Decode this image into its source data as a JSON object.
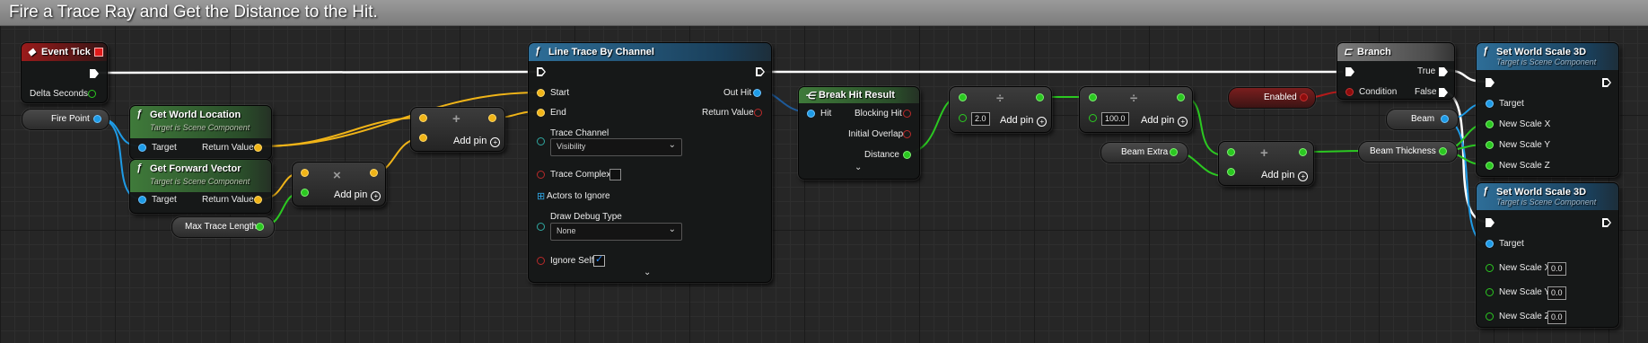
{
  "comment": {
    "title": "Fire a Trace Ray and Get the Distance to the Hit."
  },
  "event_tick": {
    "title": "Event Tick",
    "delta_label": "Delta Seconds"
  },
  "fire_point": {
    "label": "Fire Point"
  },
  "get_world_location": {
    "title": "Get World Location",
    "subtitle": "Target is Scene Component",
    "target": "Target",
    "return": "Return Value"
  },
  "get_forward_vector": {
    "title": "Get Forward Vector",
    "subtitle": "Target is Scene Component",
    "target": "Target",
    "return": "Return Value"
  },
  "max_trace_length": {
    "label": "Max Trace Length"
  },
  "multiply_node": {
    "symbol": "×",
    "add_pin": "Add pin"
  },
  "add_node_1": {
    "symbol": "+",
    "add_pin": "Add pin"
  },
  "line_trace": {
    "title": "Line Trace By Channel",
    "start": "Start",
    "end": "End",
    "out_hit": "Out Hit",
    "return_value": "Return Value",
    "trace_channel_label": "Trace Channel",
    "trace_channel_value": "Visibility",
    "trace_complex": "Trace Complex",
    "actors_to_ignore": "Actors to Ignore",
    "draw_debug_label": "Draw Debug Type",
    "draw_debug_value": "None",
    "ignore_self": "Ignore Self"
  },
  "break_hit": {
    "title": "Break Hit Result",
    "hit": "Hit",
    "blocking_hit": "Blocking Hit",
    "initial_overlap": "Initial Overlap",
    "distance": "Distance"
  },
  "divide_1": {
    "symbol": "÷",
    "value": "2.0",
    "add_pin": "Add pin"
  },
  "divide_2": {
    "symbol": "÷",
    "value": "100.0",
    "add_pin": "Add pin"
  },
  "beam_extra": {
    "label": "Beam Extra"
  },
  "add_node_2": {
    "symbol": "+",
    "add_pin": "Add pin"
  },
  "enabled": {
    "label": "Enabled"
  },
  "branch": {
    "title": "Branch",
    "condition": "Condition",
    "true_label": "True",
    "false_label": "False"
  },
  "beam": {
    "label": "Beam"
  },
  "beam_thickness": {
    "label": "Beam Thickness"
  },
  "set_scale_1": {
    "title": "Set World Scale 3D",
    "subtitle": "Target is Scene Component",
    "target": "Target",
    "x": "New Scale X",
    "y": "New Scale Y",
    "z": "New Scale Z"
  },
  "set_scale_2": {
    "title": "Set World Scale 3D",
    "subtitle": "Target is Scene Component",
    "target": "Target",
    "x": "New Scale X",
    "y": "New Scale Y",
    "z": "New Scale Z",
    "x_val": "0.0",
    "y_val": "0.0",
    "z_val": "0.0"
  },
  "colors": {
    "exec": "#ffffff",
    "object": "#1e9be6",
    "vector": "#f0b418",
    "float": "#2bc821",
    "bool": "#8e0d0d",
    "struct": "#1e5a9a"
  }
}
